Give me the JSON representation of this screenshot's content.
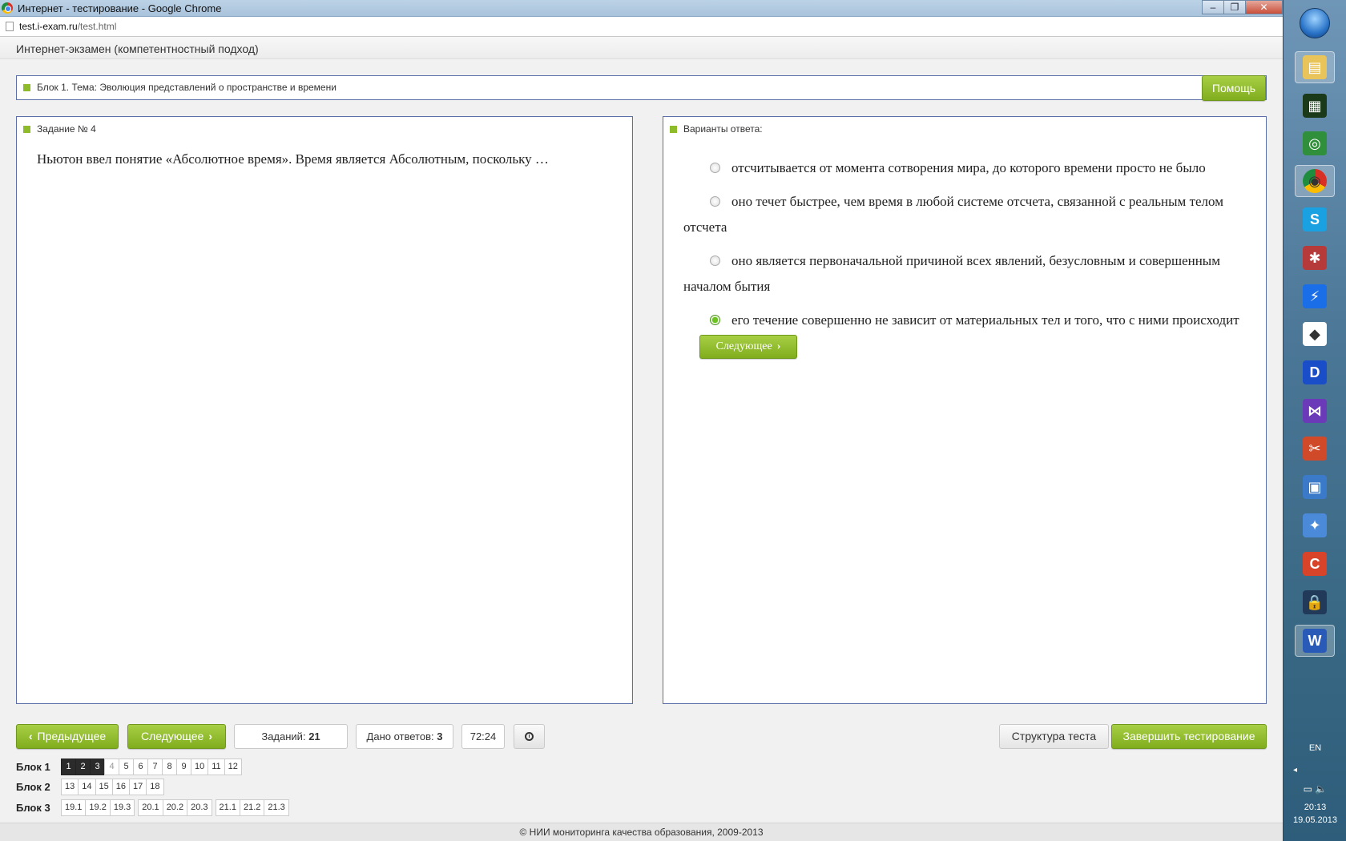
{
  "window": {
    "title": "Интернет - тестирование - Google Chrome",
    "controls": [
      "–",
      "❐",
      "✕"
    ]
  },
  "address": {
    "host": "test.i-exam.ru",
    "path": "/test.html"
  },
  "site": {
    "title": "Интернет-экзамен (компетентностный подход)"
  },
  "topic": {
    "text": "Блок 1. Тема: Эволюция представлений о пространстве и времени",
    "help_label": "Помощь"
  },
  "task": {
    "header": "Задание № 4",
    "text": "Ньютон ввел понятие «Абсолютное время». Время является Абсолютным, поскольку …"
  },
  "answers": {
    "header": "Варианты ответа:",
    "options": [
      {
        "text": "отсчитывается от момента сотворения мира, до которого времени просто не было",
        "selected": false
      },
      {
        "text": "оно течет быстрее, чем время в любой системе отсчета, связанной с реальным телом отсчета",
        "selected": false
      },
      {
        "text": "оно является первоначальной причиной всех явлений, безусловным и совершенным началом бытия",
        "selected": false
      },
      {
        "text": "его течение совершенно не зависит от материальных тел и того, что с ними происходит",
        "selected": true
      }
    ],
    "next_label": "Следующее"
  },
  "bottom": {
    "prev_label": "Предыдущее",
    "next_label": "Следующее",
    "tasks_label": "Заданий:",
    "tasks_value": "21",
    "answered_label": "Дано ответов:",
    "answered_value": "3",
    "timer": "72:24",
    "structure_label": "Структура теста",
    "finish_label": "Завершить тестирование"
  },
  "blocks": [
    {
      "label": "Блок 1",
      "groups": [
        [
          "1",
          "2",
          "3",
          "4",
          "5",
          "6",
          "7",
          "8",
          "9",
          "10",
          "11",
          "12"
        ]
      ]
    },
    {
      "label": "Блок 2",
      "groups": [
        [
          "13",
          "14",
          "15",
          "16",
          "17",
          "18"
        ]
      ]
    },
    {
      "label": "Блок 3",
      "groups": [
        [
          "19.1",
          "19.2",
          "19.3"
        ],
        [
          "20.1",
          "20.2",
          "20.3"
        ],
        [
          "21.1",
          "21.2",
          "21.3"
        ]
      ]
    }
  ],
  "footer": {
    "text": "© НИИ мониторинга качества образования, 2009-2013"
  },
  "taskbar": {
    "lang": "EN",
    "time": "20:13",
    "date": "19.05.2013",
    "icons": [
      "folder-icon",
      "matrix-app-icon",
      "network-globe-icon",
      "chrome-icon",
      "skype-icon",
      "atom-app-icon",
      "flash-app-icon",
      "foobar-icon",
      "daemon-tools-icon",
      "visual-studio-icon",
      "tools-icon",
      "monitor-shield-icon",
      "satellite-icon",
      "ccleaner-icon",
      "lock-icon",
      "word-icon"
    ]
  },
  "colors": {
    "accent_green": "#8dbb2a",
    "panel_border": "#5b6fa9",
    "done_cell": "#2b2b2b"
  }
}
